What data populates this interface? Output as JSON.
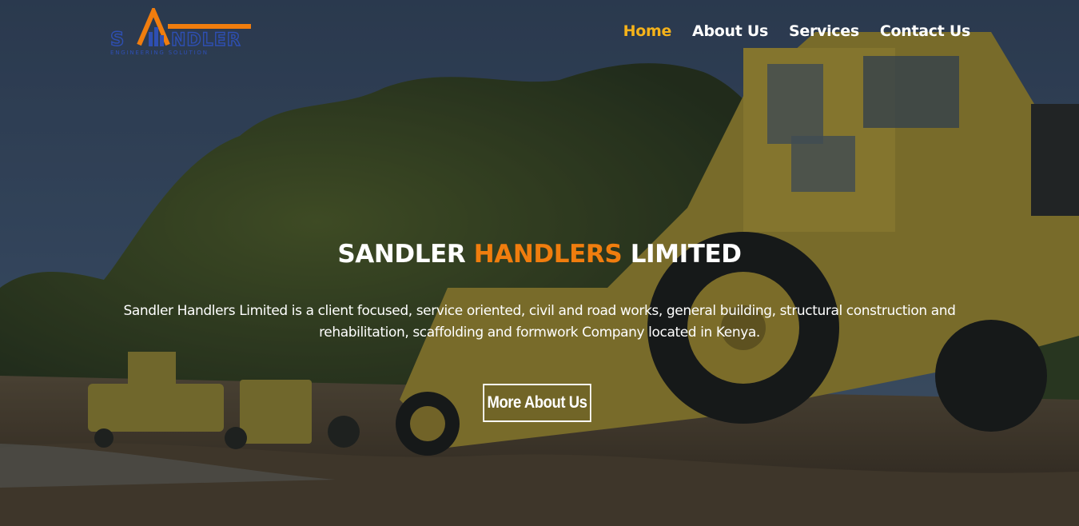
{
  "header": {
    "logo": {
      "wordmark": "SANDLER",
      "tagline": "ENGINEERING SOLUTION"
    },
    "nav": [
      {
        "label": "Home",
        "active": true
      },
      {
        "label": "About Us",
        "active": false
      },
      {
        "label": "Services",
        "active": false
      },
      {
        "label": "Contact Us",
        "active": false
      }
    ]
  },
  "hero": {
    "title_part1": "SANDLER ",
    "title_accent": "HANDLERS",
    "title_part2": " LIMITED",
    "description": "Sandler Handlers Limited is a client focused, service oriented, civil and road works, general building, structural construction and rehabilitation, scaffolding and formwork Company located in Kenya.",
    "cta_label": "More About Us",
    "background": "construction-scraper-photo"
  },
  "colors": {
    "accent_orange": "#f07d0e",
    "active_nav": "#f5b21a",
    "logo_blue": "#2e4fb3",
    "text": "#ffffff"
  }
}
